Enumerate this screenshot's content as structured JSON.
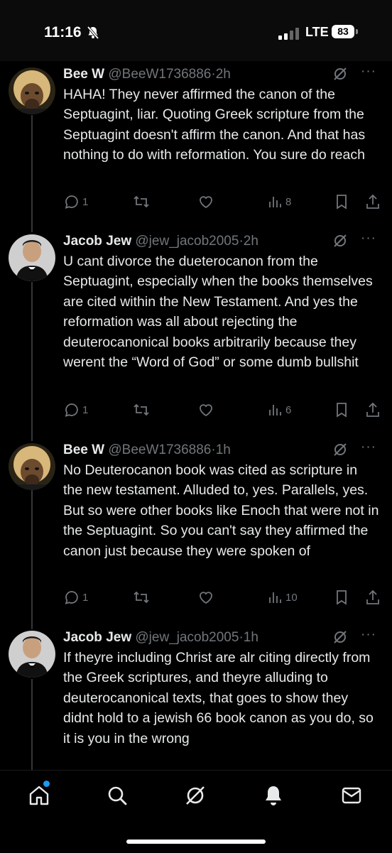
{
  "status_bar": {
    "time": "11:16",
    "network": "LTE",
    "battery": "83"
  },
  "tweets": [
    {
      "name": "Bee W",
      "handle": "@BeeW1736886",
      "sep": "·",
      "time": "2h",
      "text": "HAHA! They never affirmed the canon of the Septuagint, liar. Quoting Greek scripture from the Septuagint doesn't affirm the canon. And that has nothing to do with reformation. You sure do reach",
      "replies": "1",
      "views": "8"
    },
    {
      "name": "Jacob Jew",
      "handle": "@jew_jacob2005",
      "sep": "·",
      "time": "2h",
      "text": "U cant divorce the dueterocanon from the Septuagint, especially when the books themselves are cited within the New Testament. And yes the reformation was all about rejecting the deuterocanonical books arbitrarily because they werent the “Word of God” or some dumb bullshit",
      "replies": "1",
      "views": "6"
    },
    {
      "name": "Bee W",
      "handle": "@BeeW1736886",
      "sep": "·",
      "time": "1h",
      "text": "No Deuterocanon book was cited as scripture in the new testament. Alluded to, yes. Parallels, yes. But so were other books like Enoch that were not in the Septuagint. So you can't say they affirmed the canon just because they were spoken of",
      "replies": "1",
      "views": "10"
    },
    {
      "name": "Jacob Jew",
      "handle": "@jew_jacob2005",
      "sep": "·",
      "time": "1h",
      "text": "If theyre including Christ are alr citing directly from the Greek scriptures, and theyre alluding to deuterocanonical texts, that goes to show they didnt hold to a jewish 66 book canon as you do, so it is you in the wrong"
    }
  ],
  "icons": {
    "reply": "reply-icon",
    "retweet": "retweet-icon",
    "like": "heart-icon",
    "views": "views-icon",
    "bookmark": "bookmark-icon",
    "share": "share-icon",
    "grok": "grok-icon",
    "more": "more-icon"
  },
  "nav": [
    "home-icon",
    "search-icon",
    "grok-icon",
    "notifications-icon",
    "messages-icon"
  ],
  "colors": {
    "background": "#000000",
    "text": "#e7e9ea",
    "muted": "#71767b",
    "accent": "#1d9bf0"
  }
}
